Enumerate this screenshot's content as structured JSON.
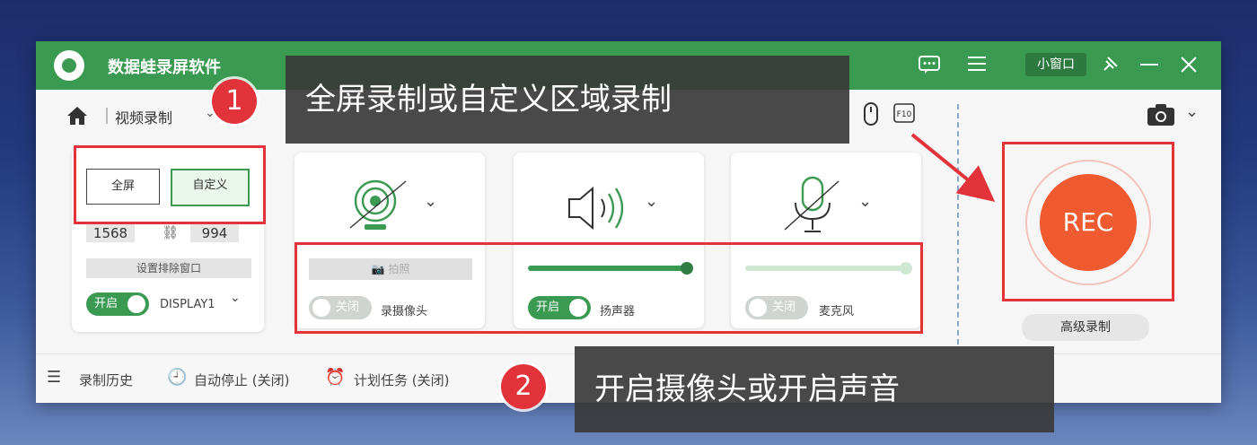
{
  "app": {
    "title": "数据蛙录屏软件"
  },
  "titlebar": {
    "mini_window": "小窗口",
    "menu_icon": "menu-icon",
    "feedback_icon": "chat-icon",
    "pin_icon": "pin-icon",
    "minimize_icon": "minimize-icon",
    "close_icon": "close-icon"
  },
  "toolbar": {
    "mode_label": "视频录制"
  },
  "area": {
    "fullscreen": "全屏",
    "custom": "自定义",
    "width": "1568",
    "height": "994",
    "exclude": "设置排除窗口",
    "toggle_on": "开启",
    "display": "DISPLAY1"
  },
  "devices": {
    "camera": {
      "label": "录摄像头",
      "toggle": "关闭",
      "photo": "拍照"
    },
    "speaker": {
      "label": "扬声器",
      "toggle": "开启",
      "level": 1.0
    },
    "mic": {
      "label": "麦克风",
      "toggle": "关闭",
      "level": 1.0
    }
  },
  "rec": {
    "label": "REC",
    "advanced": "高级录制"
  },
  "statusbar": {
    "history": "录制历史",
    "auto_stop": "自动停止 (关闭)",
    "schedule": "计划任务 (关闭)"
  },
  "annotations": {
    "badge1": "1",
    "callout1": "全屏录制或自定义区域录制",
    "badge2": "2",
    "callout2": "开启摄像头或开启声音"
  },
  "colors": {
    "brand_green": "#3b9a52",
    "rec_orange": "#f05a30",
    "annotation_red": "#e2333a"
  }
}
